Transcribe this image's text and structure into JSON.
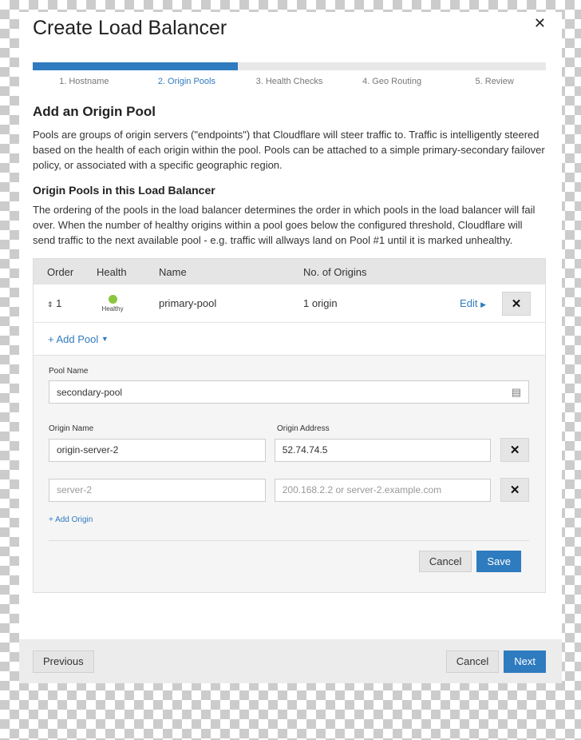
{
  "modal": {
    "title": "Create Load Balancer",
    "close": "✕"
  },
  "progress": {
    "current_step": 2,
    "total_steps": 5,
    "fraction": 0.4
  },
  "steps": [
    "1. Hostname",
    "2. Origin Pools",
    "3. Health Checks",
    "4. Geo Routing",
    "5. Review"
  ],
  "section": {
    "title": "Add an Origin Pool",
    "description": "Pools are groups of origin servers (\"endpoints\") that Cloudflare will steer traffic to. Traffic is intelligently steered based on the health of each origin within the pool. Pools can be attached to a simple primary-secondary failover policy, or associated with a specific geographic region.",
    "subtitle": "Origin Pools in this Load Balancer",
    "subdescription": "The ordering of the pools in the load balancer determines the order in which pools in the load balancer will fail over. When the number of healthy origins within a pool goes below the configured threshold, Cloudflare will send traffic to the next available pool - e.g. traffic will allways land on Pool #1 until it is marked unhealthy."
  },
  "table": {
    "headers": [
      "Order",
      "Health",
      "Name",
      "No. of Origins"
    ],
    "rows": [
      {
        "order": "1",
        "health": "Healthy",
        "name": "primary-pool",
        "origins": "1 origin",
        "edit": "Edit",
        "remove": "✕"
      }
    ],
    "add_pool": "+ Add Pool"
  },
  "form": {
    "pool_name_label": "Pool Name",
    "pool_name_value": "secondary-pool",
    "origin_name_label": "Origin Name",
    "origin_address_label": "Origin Address",
    "origins": [
      {
        "name": "origin-server-2",
        "address": "52.74.74.5"
      }
    ],
    "new_origin": {
      "name_placeholder": "server-2",
      "address_placeholder": "200.168.2.2 or server-2.example.com"
    },
    "add_origin": "+ Add Origin",
    "cancel": "Cancel",
    "save": "Save",
    "remove": "✕"
  },
  "footer": {
    "previous": "Previous",
    "cancel": "Cancel",
    "next": "Next"
  },
  "colors": {
    "accent": "#2f7bbf",
    "healthy": "#8cc63f"
  }
}
